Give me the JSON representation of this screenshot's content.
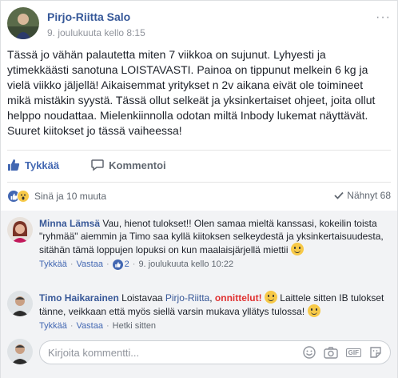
{
  "post": {
    "author": "Pirjo-Riitta Salo",
    "timestamp": "9. joulukuuta kello 8:15",
    "more_label": "···",
    "text": "Tässä jo vähän palautetta miten 7 viikkoa on sujunut. Lyhyesti ja ytimekkäästi sanotuna LOISTAVASTI. Painoa on tippunut melkein 6 kg ja vielä viikko jäljellä! Aikaisemmat yritykset n 2v aikana eivät ole toimineet mikä mistäkin syystä. Tässä ollut selkeät ja yksinkertaiset ohjeet, joita ollut helppo noudattaa. Mielenkiinnolla odotan miltä Inbody lukemat näyttävät. Suuret kiitokset jo tässä vaiheessa!"
  },
  "actions": {
    "like_label": "Tykkää",
    "comment_label": "Kommentoi"
  },
  "reactions": {
    "summary": "Sinä ja 10 muuta",
    "seen": "Nähnyt 68"
  },
  "comments": [
    {
      "name": "Minna Lämsä",
      "text": "Vau, hienot tulokset!! Olen samaa mieltä kanssasi, kokeilin toista \"ryhmää\" aiemmin ja Timo saa kyllä kiitoksen selkeydestä ja yksinkertaisuudesta, sitähän tämä loppujen lopuksi on kun maalaisjärjellä miettii",
      "like": "Tykkää",
      "reply": "Vastaa",
      "likes_count": "2",
      "time": "9. joulukuuta kello 10:22"
    },
    {
      "name": "Timo Haikarainen",
      "text_before": "Loistavaa",
      "mention": "Pirjo-Riitta",
      "congrats": "onnittelut!",
      "text_after": "Laittele sitten IB tulokset tänne, veikkaan että myös siellä varsin mukava yllätys tulossa!",
      "like": "Tykkää",
      "reply": "Vastaa",
      "time": "Hetki sitten"
    }
  ],
  "write_comment": {
    "placeholder": "Kirjoita kommentti..."
  },
  "colors": {
    "link": "#365899",
    "like_blue": "#4267b2",
    "congrats_red": "#e03131"
  }
}
